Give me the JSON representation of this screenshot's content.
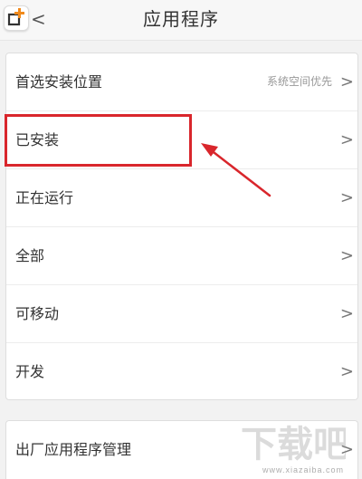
{
  "header": {
    "title": "应用程序",
    "back_glyph": "<"
  },
  "settings": {
    "rows": [
      {
        "label": "首选安装位置",
        "value": "系统空间优先"
      },
      {
        "label": "已安装"
      },
      {
        "label": "正在运行"
      },
      {
        "label": "全部"
      },
      {
        "label": "可移动"
      },
      {
        "label": "开发"
      }
    ],
    "chevron": ">"
  },
  "factory": {
    "label": "出厂应用程序管理"
  },
  "annotation": {
    "color": "#d9262c"
  },
  "watermark": {
    "brand": "下载吧",
    "url": "www.xiazaiba.com"
  },
  "icons": [
    "app-logo-icon",
    "back-icon",
    "chevron-right-icon",
    "annotation-arrow-icon"
  ]
}
